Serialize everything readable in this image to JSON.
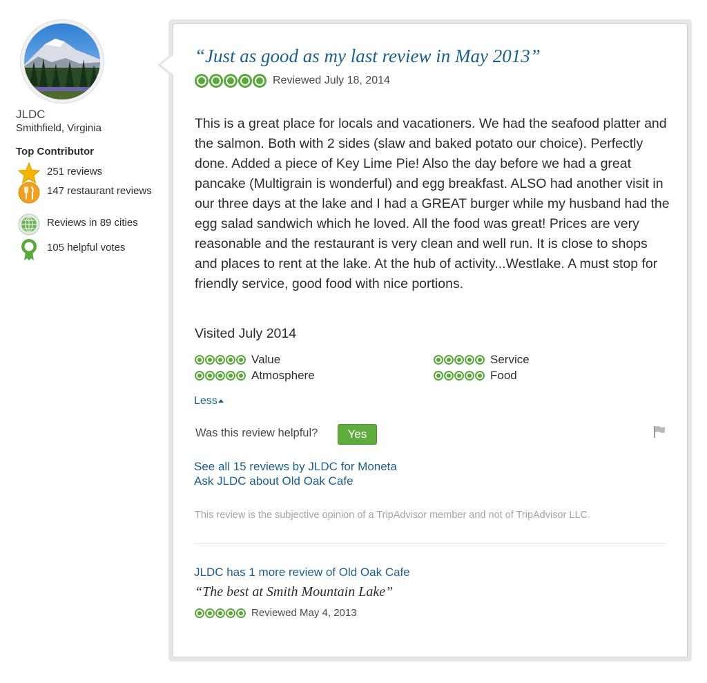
{
  "profile": {
    "username": "JLDC",
    "location": "Smithfield, Virginia",
    "badge_title": "Top Contributor",
    "stats": [
      {
        "icon": "star-icon",
        "text": "251 reviews"
      },
      {
        "icon": "restaurant-icon",
        "text": "147 restaurant reviews"
      },
      {
        "icon": "globe-icon",
        "text": "Reviews in 89 cities"
      },
      {
        "icon": "ribbon-icon",
        "text": "105 helpful votes"
      }
    ]
  },
  "review": {
    "title": "“Just as good as my last review in May 2013”",
    "rating": 5,
    "reviewed_date": "Reviewed July 18, 2014",
    "body": "This is a great place for locals and vacationers. We had the seafood platter and the salmon. Both with 2 sides (slaw and baked potato our choice). Perfectly done. Added a piece of Key Lime Pie! Also the day before we had a great pancake (Multigrain is wonderful) and egg breakfast. ALSO had another visit in our three days at the lake and I had a GREAT burger while my husband had the egg salad sandwich which he loved. All the food was great! Prices are very reasonable and the restaurant is very clean and well run. It is close to shops and places to rent at the lake. At the hub of activity...Westlake. A must stop for friendly service, good food with nice portions.",
    "visited": "Visited July 2014",
    "sub_ratings": [
      {
        "label": "Value",
        "rating": 5
      },
      {
        "label": "Service",
        "rating": 5
      },
      {
        "label": "Atmosphere",
        "rating": 5
      },
      {
        "label": "Food",
        "rating": 5
      }
    ],
    "less_label": "Less",
    "helpful_question": "Was this review helpful?",
    "yes_label": "Yes",
    "see_all_link": "See all 15 reviews by JLDC for Moneta",
    "ask_link": "Ask JLDC about Old Oak Cafe",
    "disclaimer": "This review is the subjective opinion of a TripAdvisor member and not of TripAdvisor LLC."
  },
  "more_reviews": {
    "link": "JLDC has 1 more review of Old Oak Cafe",
    "title": "“The best at Smith Mountain Lake”",
    "rating": 5,
    "reviewed_date": "Reviewed May 4, 2013"
  },
  "colors": {
    "link_blue": "#1a5f8e",
    "bubble_green": "#58a83a",
    "button_green": "#5fab3e",
    "star_gold": "#f5b400",
    "fork_orange": "#f0a020"
  }
}
